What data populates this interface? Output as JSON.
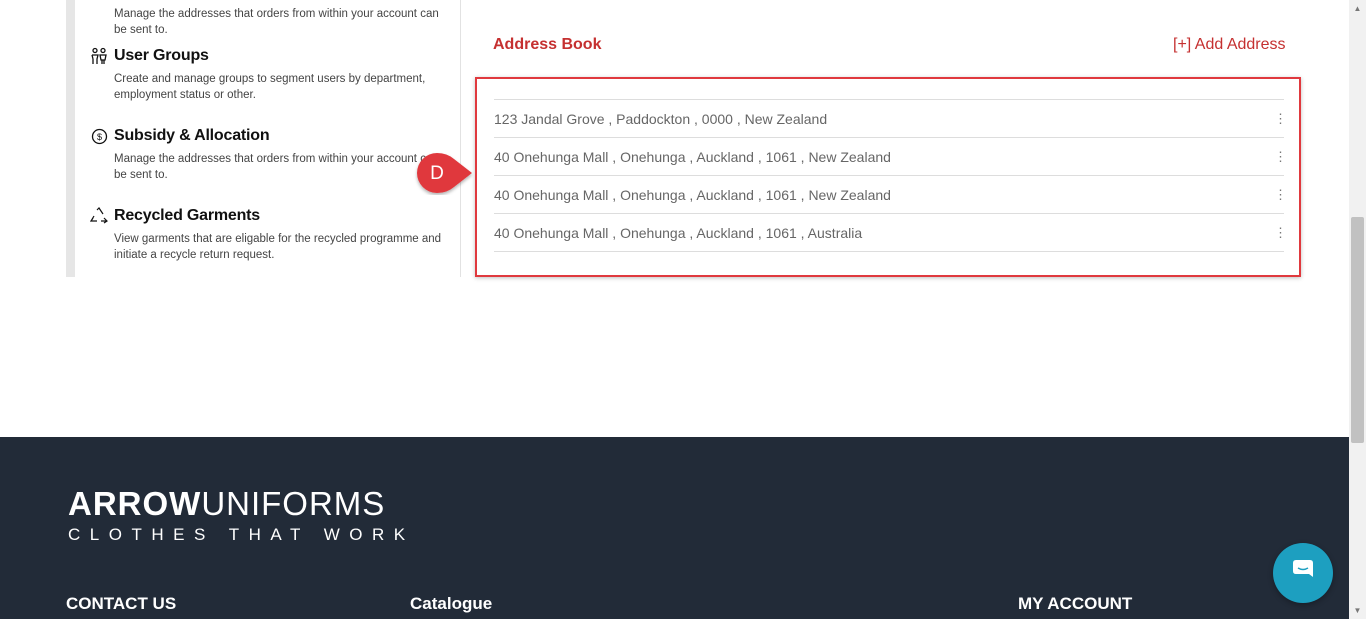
{
  "sidebar": {
    "items": [
      {
        "title": "",
        "description": "Manage the addresses that orders from within your account can be sent to.",
        "icon": "none"
      },
      {
        "title": "User Groups",
        "description": "Create and manage groups to segment users by department, employment status or other.",
        "icon": "user-groups-icon"
      },
      {
        "title": "Subsidy & Allocation",
        "description": "Manage the addresses that orders from within your account can be sent to.",
        "icon": "dollar-circle-icon"
      },
      {
        "title": "Recycled Garments",
        "description": "View garments that are eligable for the recycled programme and initiate a recycle return request.",
        "icon": "recycle-icon"
      }
    ]
  },
  "address_book": {
    "title": "Address Book",
    "add_label": "[+] Add Address",
    "addresses": [
      "123 Jandal Grove , Paddockton , 0000 , New Zealand",
      "40 Onehunga Mall , Onehunga , Auckland , 1061 , New Zealand",
      "40 Onehunga Mall , Onehunga , Auckland , 1061 , New Zealand",
      "40 Onehunga Mall , Onehunga , Auckland , 1061 , Australia"
    ],
    "menu_glyph": "⋮"
  },
  "callout": {
    "label": "D",
    "color": "#e0393e"
  },
  "footer": {
    "logo_bold": "ARROW",
    "logo_light": "UNIFORMS",
    "tagline": "CLOTHES THAT WORK",
    "columns": [
      "CONTACT US",
      "Catalogue",
      "MY ACCOUNT"
    ]
  },
  "colors": {
    "accent": "#c53030",
    "highlight": "#e0393e",
    "footer_bg": "#222b38",
    "chat": "#1d9fc0"
  }
}
